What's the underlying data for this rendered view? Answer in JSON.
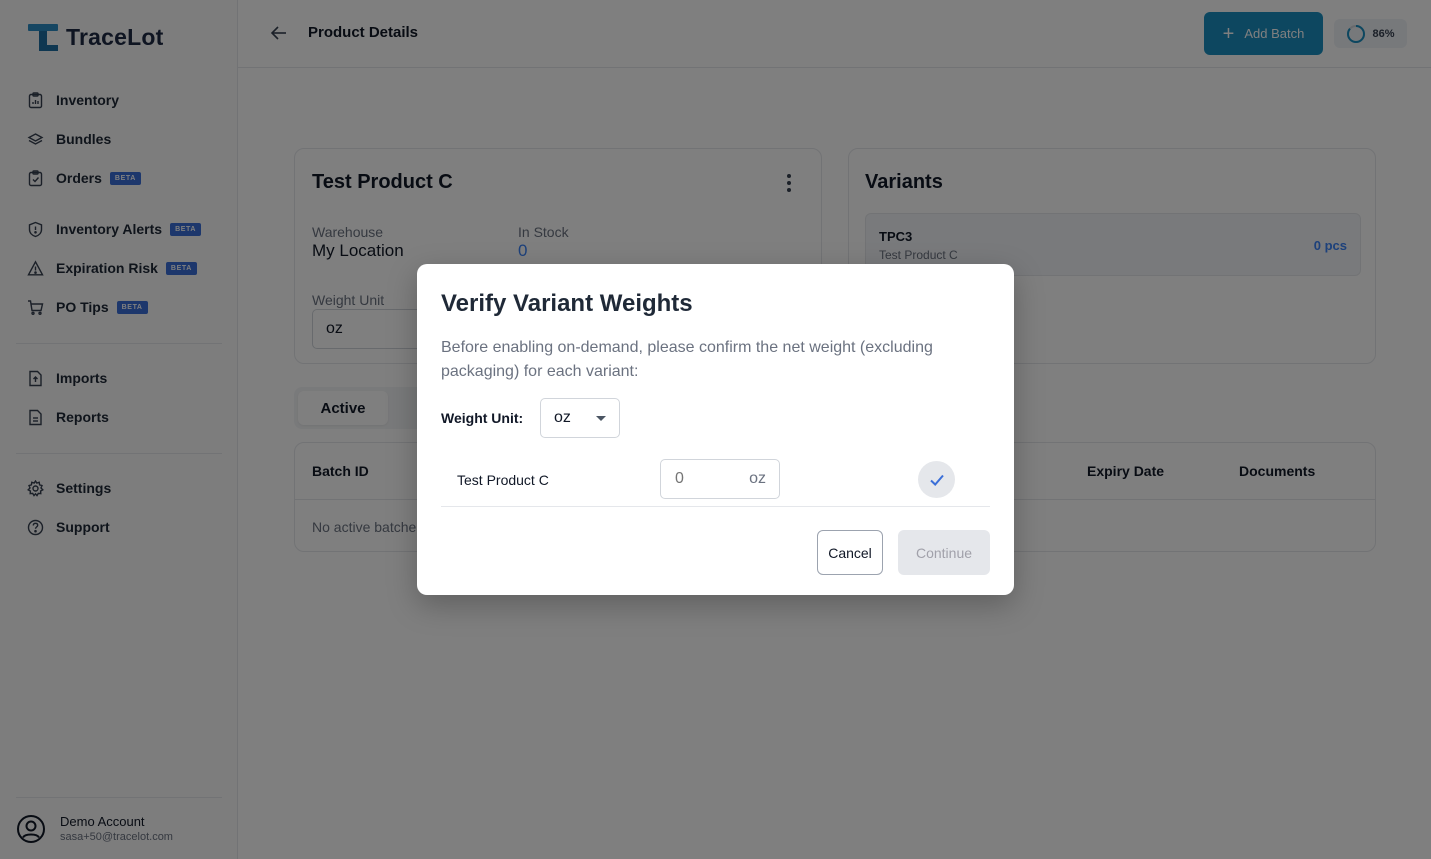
{
  "app": {
    "name": "TraceLot"
  },
  "sidebar": {
    "items": [
      {
        "label": "Inventory",
        "icon": "inventory-icon",
        "beta": ""
      },
      {
        "label": "Bundles",
        "icon": "layers-icon",
        "beta": ""
      },
      {
        "label": "Orders",
        "icon": "clipboard-icon",
        "beta": "BETA"
      },
      {
        "label": "Inventory Alerts",
        "icon": "shield-alert-icon",
        "beta": "BETA"
      },
      {
        "label": "Expiration Risk",
        "icon": "warning-icon",
        "beta": "BETA"
      },
      {
        "label": "PO Tips",
        "icon": "cart-icon",
        "beta": "BETA"
      },
      {
        "label": "Imports",
        "icon": "file-import-icon",
        "beta": ""
      },
      {
        "label": "Reports",
        "icon": "file-report-icon",
        "beta": ""
      },
      {
        "label": "Settings",
        "icon": "gear-icon",
        "beta": ""
      },
      {
        "label": "Support",
        "icon": "help-icon",
        "beta": ""
      }
    ],
    "account": {
      "name": "Demo Account",
      "email": "sasa+50@tracelot.com"
    }
  },
  "header": {
    "title": "Product Details",
    "add_batch_label": "Add Batch",
    "progress_text": "86%",
    "progress_value": 0.86
  },
  "product": {
    "name": "Test Product C",
    "warehouse_label": "Warehouse",
    "warehouse_value": "My Location",
    "stock_label": "In Stock",
    "stock_value": "0",
    "weight_unit_label": "Weight Unit",
    "weight_unit_value": "oz"
  },
  "variants": {
    "title": "Variants",
    "items": [
      {
        "sku": "TPC3",
        "name": "Test Product C",
        "qty": "0 pcs"
      }
    ]
  },
  "batches": {
    "active_tab": "Active",
    "columns": [
      "Batch ID",
      "Expiry Date",
      "Documents"
    ],
    "empty_text": "No active batche"
  },
  "modal": {
    "title": "Verify Variant Weights",
    "description": "Before enabling on-demand, please confirm the net weight (excluding packaging) for each variant:",
    "weight_unit_label": "Weight Unit:",
    "weight_unit_value": "oz",
    "rows": [
      {
        "name": "Test Product C",
        "placeholder": "0",
        "unit": "oz"
      }
    ],
    "cancel_label": "Cancel",
    "continue_label": "Continue"
  },
  "colors": {
    "accent": "#1a8fc0",
    "beta_badge": "#3b6fd8",
    "link_blue": "#3b82f6"
  }
}
